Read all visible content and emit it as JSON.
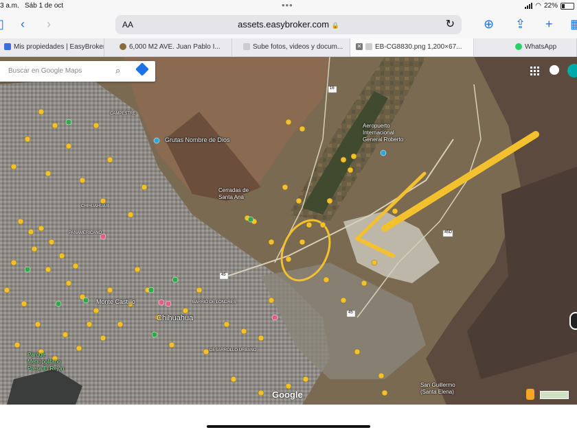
{
  "status_bar": {
    "time": "3 a.m.",
    "date": "Sáb 1 de oct",
    "battery": "22%"
  },
  "toolbar": {
    "text_size": "AA",
    "url": "assets.easybroker.com",
    "lock_icon": "lock-icon",
    "reload_icon": "reload-icon"
  },
  "tabs": [
    {
      "label": "Mis propiedades | EasyBroker",
      "active": false
    },
    {
      "label": "6,000 M2 AVE. Juan Pablo I...",
      "active": false
    },
    {
      "label": "Sube fotos, videos y docum...",
      "active": false
    },
    {
      "label": "EB-CG8830.png 1,200×67...",
      "active": true
    },
    {
      "label": "WhatsApp",
      "active": false
    }
  ],
  "map": {
    "search_placeholder": "Buscar en Google Maps",
    "labels": {
      "grutas": "Grutas Nombre de Dios",
      "aeropuerto": "Aeropuerto Internacional General Roberto",
      "cerradas": "Cerradas de Santa Ana",
      "chihuahua": "Chihuahua",
      "parque": "Parque Metropolitano Presa El Rejón",
      "san_guillermo": "San Guillermo (Santa Elena)",
      "chihuahua_ii": "CHIHUAHUA II",
      "panamericano": "PANAMERICANO",
      "campestre": "CAMPESTRE",
      "barrio": "BARRIO DE LONDRES",
      "desarrollo": "DESARROLLO URBANO",
      "monte_cumbres": "Monte Castillo"
    },
    "route_numbers": [
      "16",
      "45",
      "45",
      "45",
      "45D"
    ],
    "google_logo": "Google",
    "annotation_color": "#f4c12e"
  }
}
